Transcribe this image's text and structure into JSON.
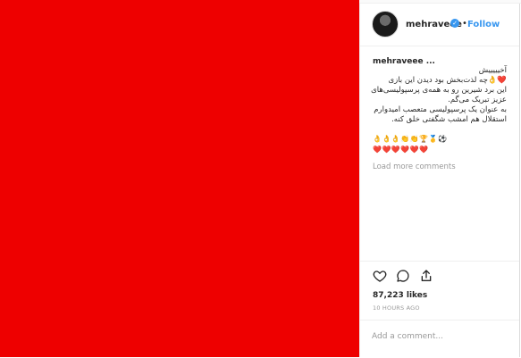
{
  "post": {
    "username": "mehraveee",
    "verified_glyph": "✓",
    "follow_separator": "•",
    "follow_label": "Follow",
    "media_color": "#ee0000"
  },
  "caption": {
    "username": "mehraveee ...",
    "lines": [
      "آخیییییش",
      "❤️👌چه لذت‌بخش بود دیدن این بازی",
      "این برد شیرین رو به همه‌ی پرسپولیسی‌های",
      "عزیز تبریک می‌گم.",
      "به عنوان یک پرسپولیسی متعصب امیدوارم",
      "استقلال هم امشب شگفتی خلق کنه."
    ],
    "emoji_line_1": "👌👌👌👏👏🏆🥇⚽",
    "emoji_line_2": "❤️❤️❤️❤️❤️❤️"
  },
  "comments": {
    "load_more_label": "Load more comments"
  },
  "actions": {
    "like_icon": "heart-icon",
    "comment_icon": "comment-icon",
    "share_icon": "share-icon"
  },
  "stats": {
    "likes_text": "87,223 likes",
    "time_text": "10 HOURS AGO"
  },
  "comment_input": {
    "placeholder": "Add a comment..."
  },
  "colors": {
    "accent": "#3897f0",
    "text": "#262626",
    "muted": "#999999"
  }
}
